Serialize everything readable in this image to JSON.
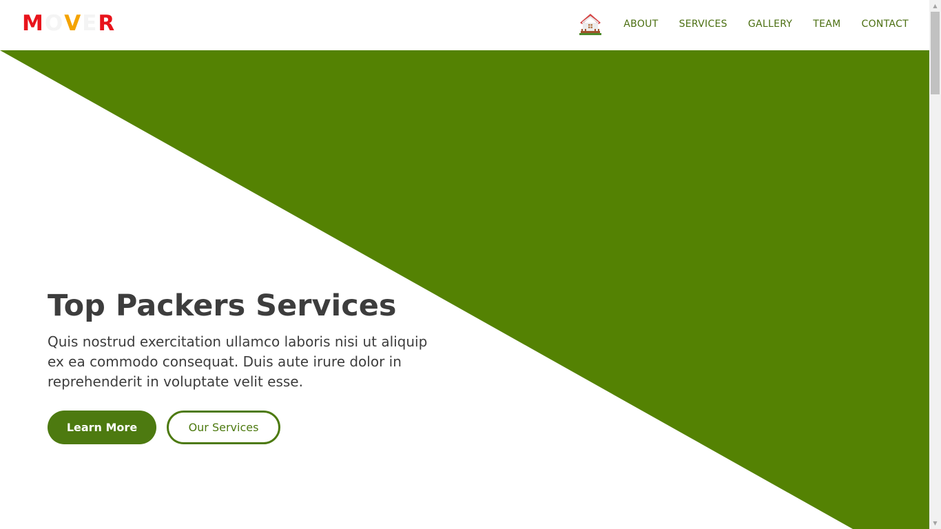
{
  "logo": {
    "letters": [
      {
        "char": "M",
        "color": "#e8141c"
      },
      {
        "char": "O",
        "color": "#f4f4f4"
      },
      {
        "char": "V",
        "color": "#f4a300"
      },
      {
        "char": "E",
        "color": "#f4f4f4"
      },
      {
        "char": "R",
        "color": "#e8141c"
      }
    ]
  },
  "nav": {
    "home_icon": "house-icon",
    "items": [
      {
        "label": "ABOUT"
      },
      {
        "label": "SERVICES"
      },
      {
        "label": "GALLERY"
      },
      {
        "label": "TEAM"
      },
      {
        "label": "CONTACT"
      }
    ]
  },
  "hero": {
    "title": "Top Packers Services",
    "description": "Quis nostrud exercitation ullamco laboris nisi ut aliquip ex ea commodo consequat. Duis aute irure dolor in reprehenderit in voluptate velit esse.",
    "primary_button": "Learn More",
    "secondary_button": "Our Services"
  },
  "colors": {
    "accent": "#548203",
    "nav_text": "#4a6e10",
    "heading": "#3d3d3d",
    "logo_red": "#e8141c",
    "logo_orange": "#f4a300"
  }
}
